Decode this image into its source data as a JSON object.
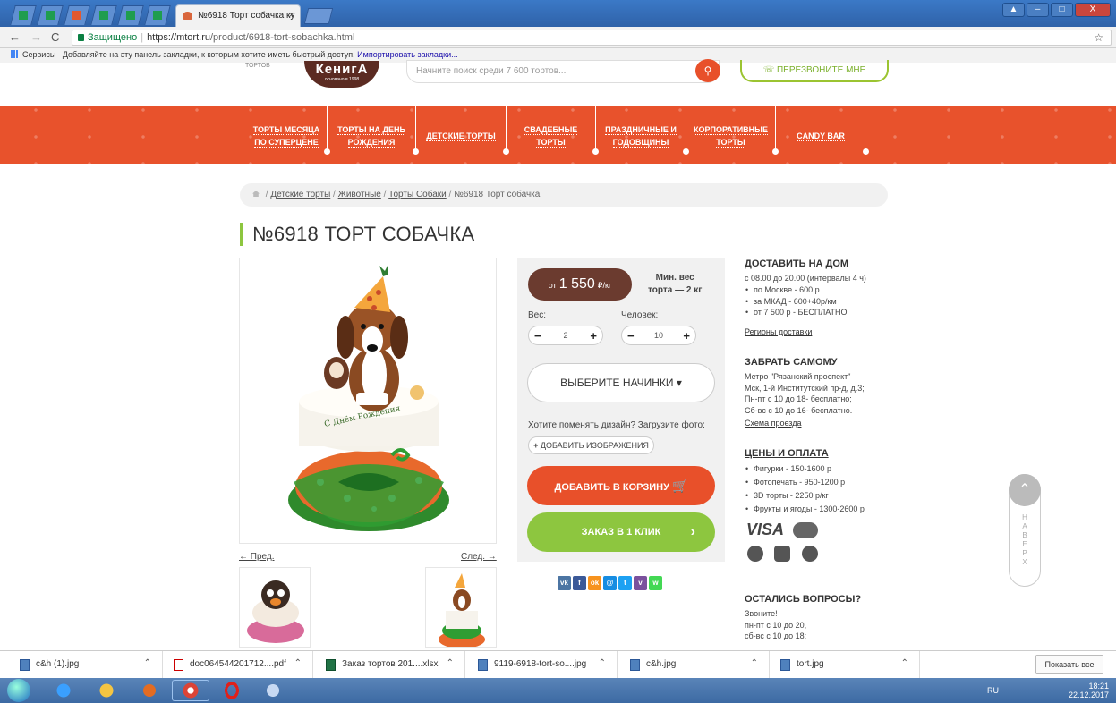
{
  "browser": {
    "tab_title": "№6918 Торт собачка ку",
    "tab_close": "×",
    "window_close": "X",
    "url_secure_label": "Защищено",
    "url_host": "https://mtort.ru",
    "url_path": "/product/6918-tort-sobachka.html",
    "bookmarks_apps": "Сервисы",
    "bookmarks_hint": "Добавляйте на эту панель закладки, к которым хотите иметь быстрый доступ.",
    "bookmarks_import": "Импортировать закладки..."
  },
  "header": {
    "logo_text": "КенигА",
    "logo_sub": "основано в 1998",
    "logo_left_text": "ТОРТОВ",
    "search_placeholder": "Начните поиск среди 7 600 тортов...",
    "call_button": "ПЕРЕЗВОНИТЕ МНЕ"
  },
  "menu": [
    {
      "line1": "ТОРТЫ МЕСЯЦА",
      "line2": "ПО СУПЕРЦЕНЕ"
    },
    {
      "line1": "ТОРТЫ НА ДЕНЬ",
      "line2": "РОЖДЕНИЯ"
    },
    {
      "line1": "ДЕТСКИЕ ТОРТЫ",
      "line2": ""
    },
    {
      "line1": "СВАДЕБНЫЕ",
      "line2": "ТОРТЫ"
    },
    {
      "line1": "ПРАЗДНИЧНЫЕ И",
      "line2": "ГОДОВЩИНЫ"
    },
    {
      "line1": "КОРПОРАТИВНЫЕ",
      "line2": "ТОРТЫ"
    },
    {
      "line1": "CANDY BAR",
      "line2": ""
    }
  ],
  "breadcrumb": {
    "items": [
      "Детские торты",
      "Животные",
      "Торты Собаки"
    ],
    "current": "№6918 Торт собачка"
  },
  "product": {
    "title": "№6918 ТОРТ СОБАЧКА",
    "prev": "← Пред.",
    "next": "След. →",
    "price_prefix": "от",
    "price_value": "1 550",
    "price_unit": "₽/кг",
    "min_weight_line1": "Мин. вес",
    "min_weight_line2": "торта — 2 кг",
    "weight_label": "Вес:",
    "weight_value": "2",
    "people_label": "Человек:",
    "people_value": "10",
    "fillings_button": "ВЫБЕРИТЕ НАЧИНКИ ▾",
    "design_question": "Хотите поменять дизайн? Загрузите фото:",
    "add_image_button": "ДОБАВИТЬ ИЗОБРАЖЕНИЯ",
    "cart_button": "ДОБАВИТЬ В КОРЗИНУ",
    "one_click_button": "ЗАКАЗ В 1 КЛИК"
  },
  "social": [
    {
      "icon": "vk-icon",
      "label": "vk",
      "color": "#4c75a3"
    },
    {
      "icon": "facebook-icon",
      "label": "f",
      "color": "#3b5998"
    },
    {
      "icon": "odnoklassniki-icon",
      "label": "ok",
      "color": "#f7931e"
    },
    {
      "icon": "moimir-icon",
      "label": "@",
      "color": "#168de2"
    },
    {
      "icon": "twitter-icon",
      "label": "t",
      "color": "#1da1f2"
    },
    {
      "icon": "viber-icon",
      "label": "v",
      "color": "#7b519d"
    },
    {
      "icon": "whatsapp-icon",
      "label": "w",
      "color": "#43d854"
    }
  ],
  "info": {
    "delivery_title": "ДОСТАВИТЬ НА ДОМ",
    "delivery_hours": "с 08.00 до 20.00 (интервалы 4 ч)",
    "delivery_items": [
      "по Москве - 600 р",
      "за МКАД - 600+40р/км",
      "от 7 500 р - БЕСПЛАТНО"
    ],
    "delivery_regions": "Регионы доставки",
    "pickup_title": "ЗАБРАТЬ САМОМУ",
    "pickup_lines": [
      "Метро \"Рязанский проспект\"",
      "Мск, 1-й Институтский пр-д, д.3;",
      "Пн-пт с 10 до 18- бесплатно;",
      "Сб-вс с 10 до 16- бесплатно."
    ],
    "pickup_map": "Схема проезда",
    "prices_title": "ЦЕНЫ И ОПЛАТА",
    "prices_items": [
      "Фигурки - 150-1600 р",
      "Фотопечать - 950-1200 р",
      "3D торты - 2250 р/кг",
      "Фрукты и ягоды - 1300-2600 р"
    ],
    "visa": "VISA",
    "questions_title": "ОСТАЛИСЬ ВОПРОСЫ?",
    "questions_lines": [
      "Звоните!",
      "пн-пт с 10 до 20,",
      "сб-вс с 10 до 18;"
    ]
  },
  "up_button_label": [
    "Н",
    "А",
    "В",
    "Е",
    "Р",
    "Х"
  ],
  "downloads": [
    {
      "name": "c&h (1).jpg",
      "type": "jpg"
    },
    {
      "name": "doc064544201712....pdf",
      "type": "pdf"
    },
    {
      "name": "Заказ тортов 201....xlsx",
      "type": "xlsx"
    },
    {
      "name": "9119-6918-tort-so....jpg",
      "type": "jpg"
    },
    {
      "name": "c&h.jpg",
      "type": "jpg"
    },
    {
      "name": "tort.jpg",
      "type": "jpg"
    }
  ],
  "downloads_show_all": "Показать все",
  "taskbar": {
    "lang": "RU",
    "time": "18:21",
    "date": "22.12.2017"
  }
}
